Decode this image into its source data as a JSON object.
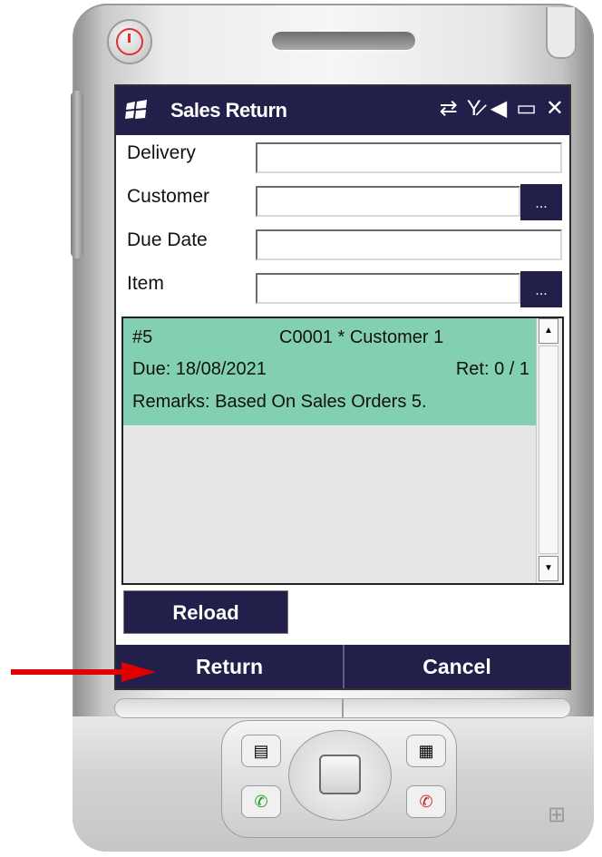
{
  "app": {
    "title": "Sales Return"
  },
  "status_icons": [
    "sync-icon",
    "no-signal-icon",
    "speaker-icon",
    "battery-icon"
  ],
  "form": {
    "delivery": {
      "label": "Delivery",
      "value": ""
    },
    "customer": {
      "label": "Customer",
      "value": "",
      "browse_label": "..."
    },
    "due_date": {
      "label": "Due Date",
      "value": ""
    },
    "item": {
      "label": "Item",
      "value": "",
      "browse_label": "..."
    }
  },
  "list": {
    "items": [
      {
        "number": "#5",
        "customer": "C0001 * Customer 1",
        "due": "Due: 18/08/2021",
        "ret": "Ret: 0 / 1",
        "remarks": "Remarks: Based On Sales Orders 5."
      }
    ]
  },
  "buttons": {
    "reload": "Reload",
    "return": "Return",
    "cancel": "Cancel"
  },
  "colors": {
    "titlebar": "#22204a",
    "selected_item": "#82d0b1",
    "arrow": "#e00000"
  }
}
